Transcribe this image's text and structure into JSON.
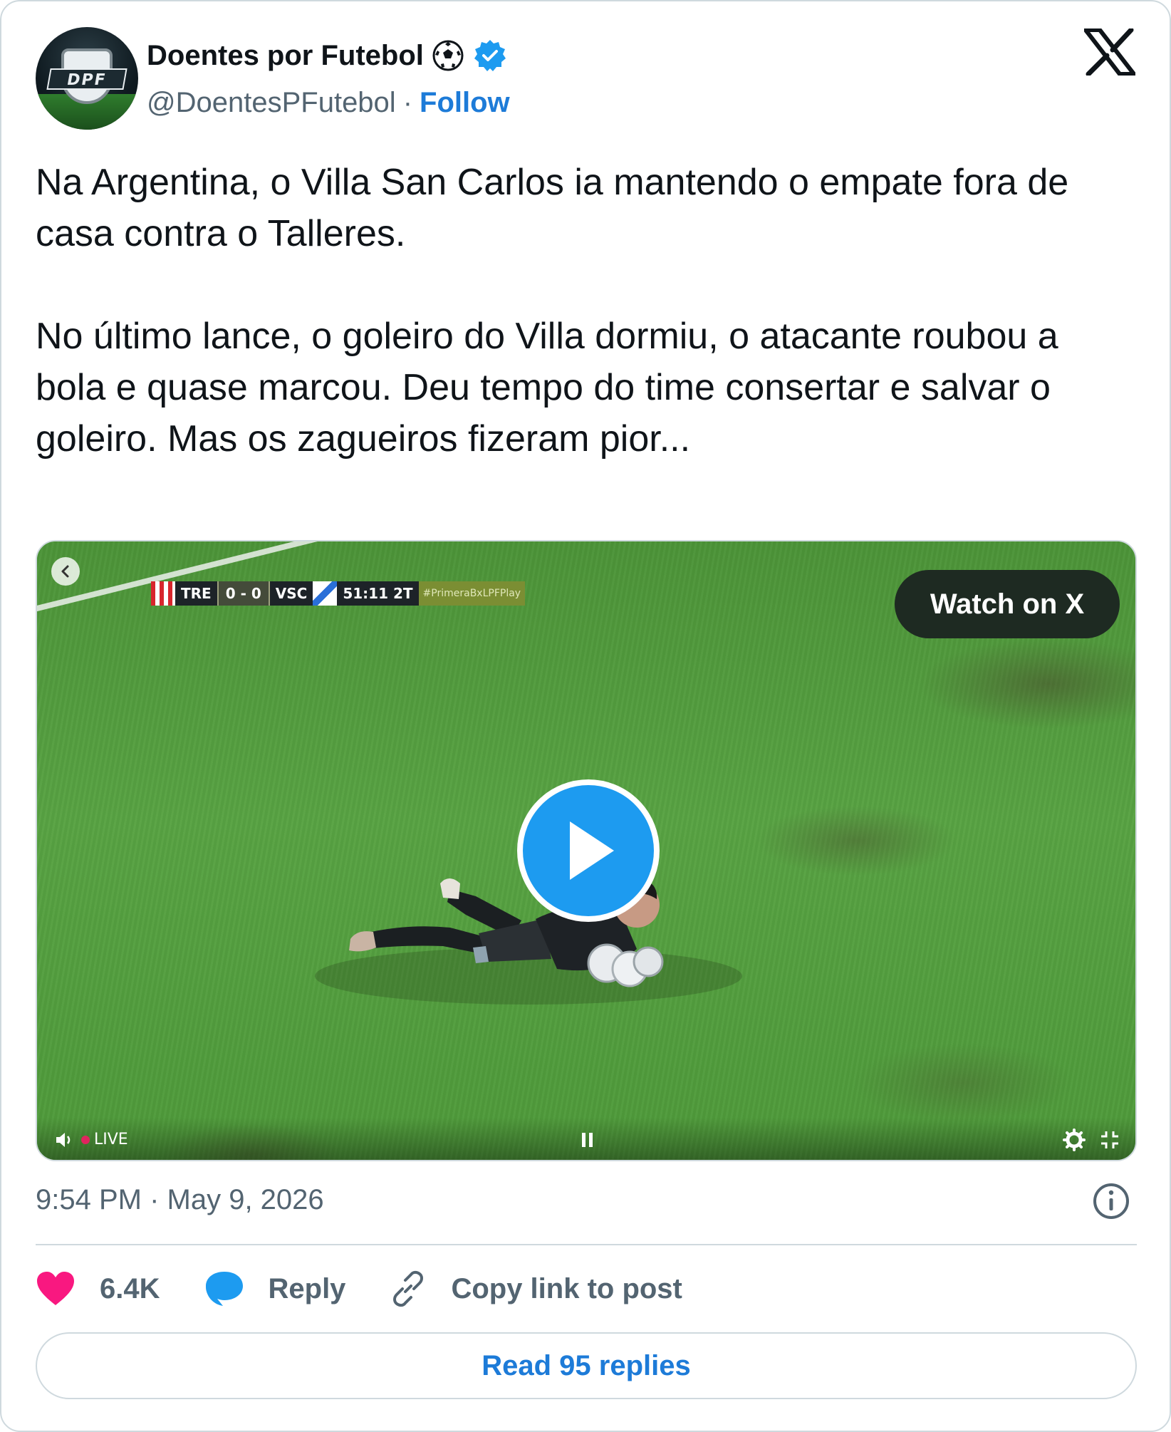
{
  "author": {
    "display_name": "Doentes por Futebol",
    "handle": "@DoentesPFutebol",
    "separator": "·",
    "follow_label": "Follow",
    "avatar_text": "DPF",
    "emoji_icon": "soccer-ball-icon",
    "verified_icon": "verified-badge-icon"
  },
  "platform_logo": "x-logo-icon",
  "tweet": {
    "text": "Na Argentina, o Villa San Carlos ia mantendo o empate fora de casa contra o Talleres.\n\nNo último lance, o goleiro do Villa dormiu, o atacante roubou a bola e quase marcou. Deu tempo do time consertar e salvar o goleiro. Mas os zagueiros fizeram pior..."
  },
  "video": {
    "watch_label": "Watch on X",
    "scoreboard": {
      "home": "TRE",
      "score": "0 - 0",
      "away": "VSC",
      "clock": "51:11 2T",
      "hashtag": "#PrimeraBxLPFPlay"
    },
    "live_label": "LIVE",
    "icons": [
      "back-icon",
      "play-icon",
      "volume-icon",
      "pause-icon",
      "gear-icon",
      "fullscreen-exit-icon"
    ]
  },
  "meta": {
    "timestamp": "9:54 PM · May 9, 2026"
  },
  "actions": {
    "likes": "6.4K",
    "reply_label": "Reply",
    "copy_label": "Copy link to post"
  },
  "read_replies_label": "Read 95 replies",
  "colors": {
    "accent": "#1d9bf0",
    "link": "#1d7bd8",
    "heart": "#f91880",
    "muted": "#536471"
  }
}
